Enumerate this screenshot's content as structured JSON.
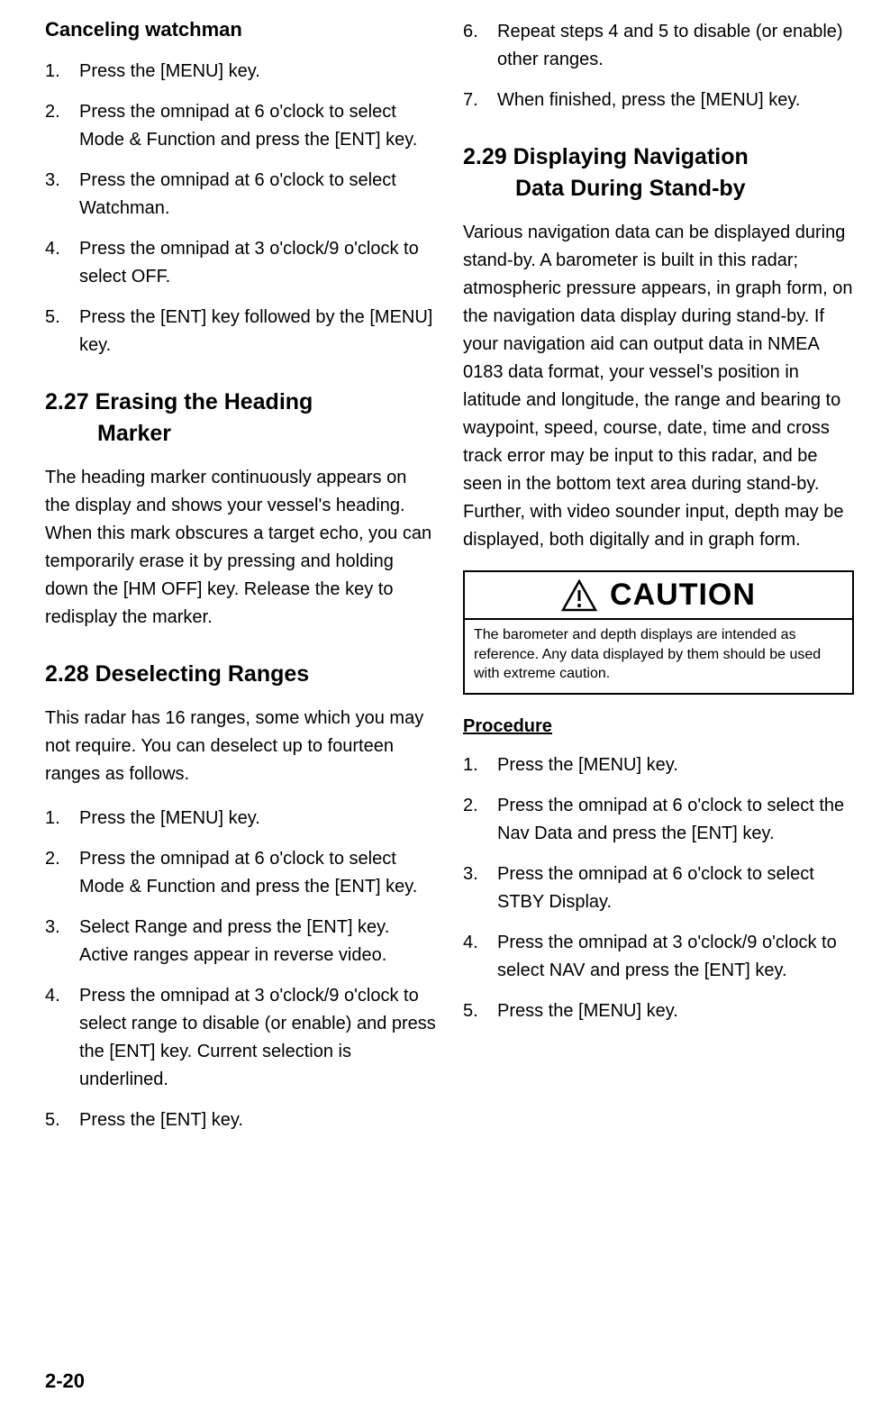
{
  "left": {
    "sub_heading": "Canceling watchman",
    "cancel_steps": [
      "Press the [MENU] key.",
      "Press the omnipad at 6 o'clock to select Mode & Function and press the [ENT] key.",
      "Press the omnipad at 6 o'clock to select Watchman.",
      "Press the omnipad at 3 o'clock/9 o'clock to select OFF.",
      "Press the [ENT] key followed by the [MENU] key."
    ],
    "s227_title_l1": "2.27 Erasing the Heading",
    "s227_title_l2": "Marker",
    "s227_body": "The heading marker continuously appears on the display and shows your vessel's heading. When this mark obscures a target echo, you can temporarily erase it by pressing and holding down the [HM OFF] key. Release the key to redisplay the marker.",
    "s228_title": "2.28 Deselecting Ranges",
    "s228_body": "This radar has 16 ranges, some which you may not require. You can deselect up to fourteen ranges as follows.",
    "s228_steps": [
      "Press the [MENU] key.",
      "Press the omnipad at 6 o'clock to select Mode & Function and press the [ENT] key.",
      "Select Range and press the [ENT] key. Active ranges appear in reverse video.",
      "Press the omnipad at 3 o'clock/9 o'clock to select range to disable (or enable) and press the [ENT] key. Current selection is underlined.",
      "Press the [ENT] key."
    ]
  },
  "right": {
    "s228_cont_steps": [
      "Repeat steps 4 and 5 to disable (or enable) other ranges.",
      "When finished, press the [MENU] key."
    ],
    "s229_title_l1": "2.29 Displaying Navigation",
    "s229_title_l2": "Data During Stand-by",
    "s229_body": "Various navigation data can be displayed during stand-by. A barometer is built in this radar; atmospheric pressure appears, in graph form, on the navigation data display during stand-by. If your navigation aid can output data in NMEA 0183 data format, your vessel's position in latitude and longitude, the range and bearing to waypoint, speed, course, date, time and cross track error may be input to this radar, and be seen in the bottom text area during stand-by. Further, with video sounder input, depth may be displayed, both digitally and in graph form.",
    "caution_title": "CAUTION",
    "caution_body": "The barometer and depth displays are intended as reference. Any data displayed by them should be used with extreme caution.",
    "procedure_label": "Procedure",
    "procedure_steps": [
      "Press the [MENU] key.",
      "Press the omnipad at 6 o'clock to select the Nav Data and press the [ENT] key.",
      "Press the omnipad at 6 o'clock to select STBY Display.",
      "Press the omnipad at 3 o'clock/9 o'clock to select NAV and press the [ENT] key.",
      "Press the [MENU] key."
    ]
  },
  "page_number": "2-20"
}
